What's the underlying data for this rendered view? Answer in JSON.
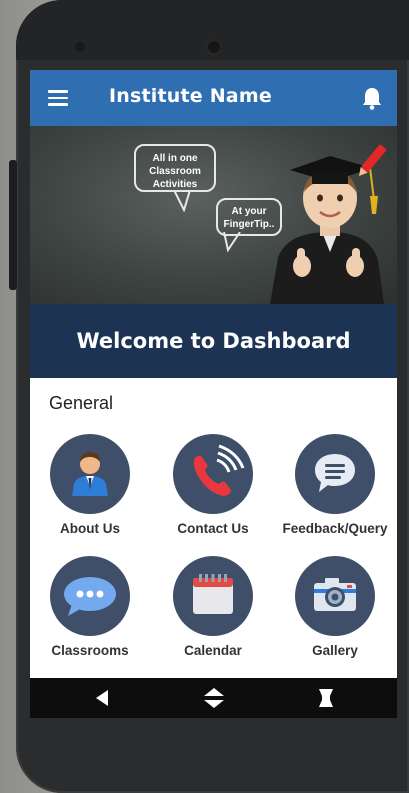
{
  "app": {
    "title": "Institute Name"
  },
  "banner": {
    "bubble_one": [
      "All in one",
      "Classroom",
      "Activities"
    ],
    "bubble_two": [
      "At your",
      "FingerTip.."
    ]
  },
  "welcome": "Welcome to Dashboard",
  "section_title": "General",
  "tiles": [
    {
      "label": "About Us",
      "icon": "user-icon"
    },
    {
      "label": "Contact Us",
      "icon": "phone-icon"
    },
    {
      "label": "Feedback/Query",
      "icon": "chat-bubble-icon"
    },
    {
      "label": "Classrooms",
      "icon": "dots-bubble-icon"
    },
    {
      "label": "Calendar",
      "icon": "calendar-icon"
    },
    {
      "label": "Gallery",
      "icon": "camera-icon"
    }
  ],
  "colors": {
    "appbar": "#2f6eb1",
    "welcome_band": "#1d3353",
    "tile_circle": "#3f4f6a"
  }
}
